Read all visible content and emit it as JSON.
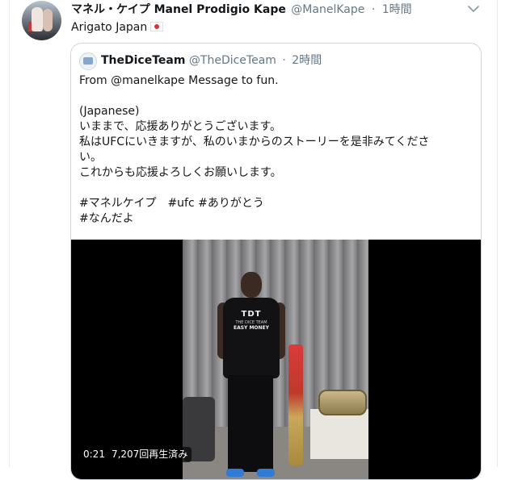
{
  "tweet": {
    "author_name": "マネル・ケイプ Manel Prodigio Kape",
    "author_handle": "@ManelKape",
    "separator": "·",
    "time": "1時間",
    "text": "Arigato Japan",
    "flag_icon": "japan-flag-icon"
  },
  "quoted_tweet": {
    "author_name": "TheDiceTeam",
    "author_handle": "@TheDiceTeam",
    "separator": "·",
    "time": "2時間",
    "lines": [
      "From @manelkape Message to fun.",
      "",
      "(Japanese)",
      "いままで、応援ありがとうございます。",
      "私はUFCにいきますが、私のいまからのストーリーを是非みてくださ",
      "い。",
      "これからも応援よろしくお願いします。",
      "",
      "#マネルケイプ　#ufc #ありがとう",
      "#なんだよ"
    ]
  },
  "video": {
    "duration": "0:21",
    "views": "7,207回再生済み",
    "shirt_logo": "TDT",
    "shirt_line1": "THE DICE TEAM",
    "shirt_line2": "EASY MONEY"
  },
  "colors": {
    "text": "#14171a",
    "secondary": "#657786",
    "border": "#ccd6dd",
    "video_bg": "#000000"
  }
}
